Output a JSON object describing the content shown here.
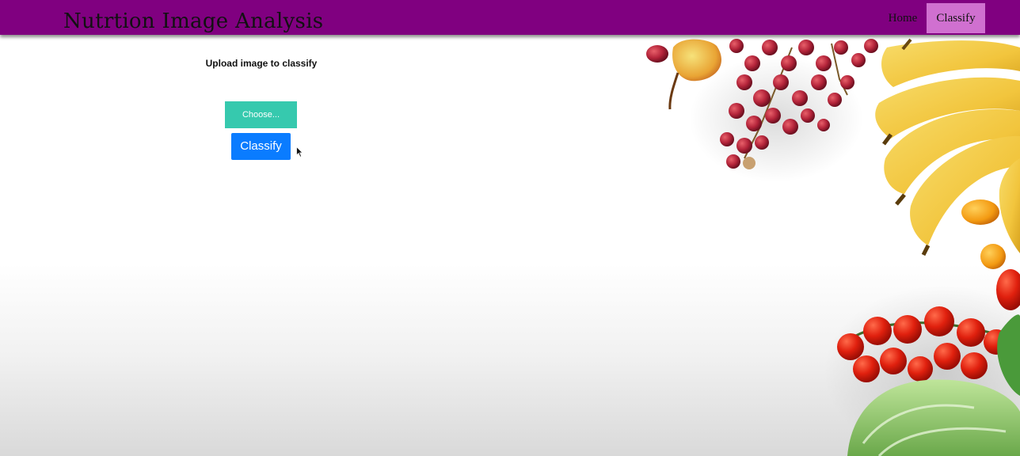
{
  "app": {
    "title": "Nutrtion Image Analysis"
  },
  "nav": {
    "items": [
      {
        "label": "Home",
        "active": false
      },
      {
        "label": "Classify",
        "active": true
      }
    ]
  },
  "upload": {
    "heading": "Upload image to classify",
    "choose_label": "Choose...",
    "classify_label": "Classify"
  },
  "colors": {
    "navbar": "#800080",
    "active_nav": "#d070d0",
    "choose_button": "#36c9ae",
    "classify_button": "#0a7cff"
  },
  "icons": {
    "cursor": "mouse-pointer-icon"
  }
}
